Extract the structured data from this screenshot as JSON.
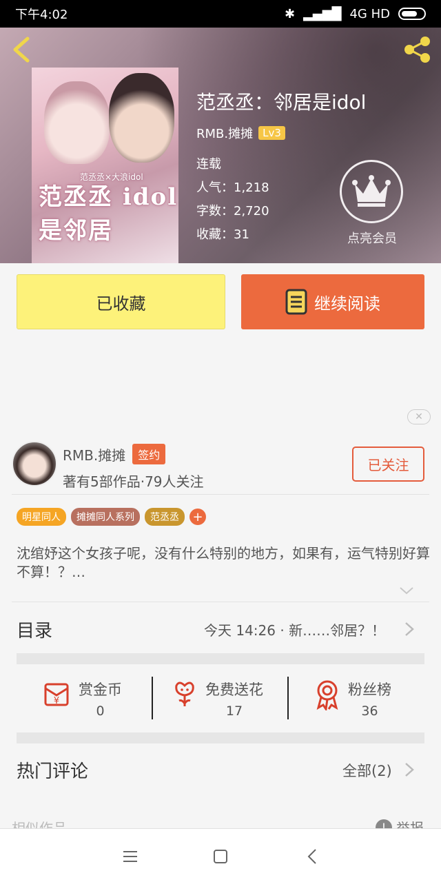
{
  "status_bar": {
    "time": "下午4:02",
    "network": "4G HD"
  },
  "book": {
    "title": "范丞丞：邻居是idol",
    "author": "RMB.摊摊",
    "level": "Lv3",
    "status": "连载",
    "popularity": "人气：1,218",
    "word_count": "字数：2,720",
    "favorites": "收藏：31",
    "cover_title_art": "范丞丞 idol是邻居",
    "cover_subtitle_art": "范丞丞×大浪idol"
  },
  "vip": {
    "label": "点亮会员"
  },
  "actions": {
    "collected_label": "已收藏",
    "read_label": "继续阅读"
  },
  "ad_close": "✕",
  "author_info": {
    "name": "RMB.摊摊",
    "badge": "签约",
    "meta": "著有5部作品·79人关注",
    "follow_label": "已关注"
  },
  "tags": [
    {
      "label": "明星同人",
      "color": "#f5a524"
    },
    {
      "label": "摊摊同人系列",
      "color": "#b8705f"
    },
    {
      "label": "范丞丞",
      "color": "#c9962e"
    }
  ],
  "tag_add": "+",
  "synopsis": "沈绾妤这个女孩子呢，没有什么特别的地方，如果有，运气特别好算不算！？…",
  "catalog": {
    "title": "目录",
    "latest": "今天 14:26 · 新……邻居？！"
  },
  "stats": [
    {
      "label": "赏金币",
      "value": "0",
      "icon": "red-envelope-icon"
    },
    {
      "label": "免费送花",
      "value": "17",
      "icon": "flower-icon"
    },
    {
      "label": "粉丝榜",
      "value": "36",
      "icon": "medal-icon"
    }
  ],
  "comments": {
    "title": "热门评论",
    "all_label": "全部(2)"
  },
  "similar": {
    "title": "相似作品"
  },
  "report": {
    "label": "举报",
    "icon": "!"
  },
  "colors": {
    "accent": "#ec6a3e",
    "collected_bg": "#fdf27a",
    "lv_badge": "#f6c646"
  }
}
